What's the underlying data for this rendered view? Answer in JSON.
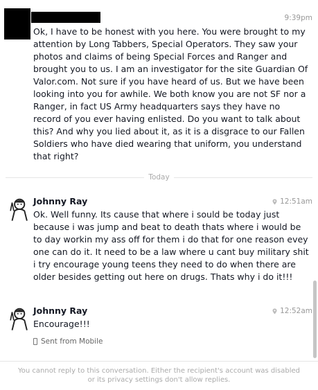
{
  "messages": [
    {
      "sender": "",
      "time": "9:39pm",
      "text": "Ok, I have to be honest with you here. You were brought to my attention by Long Tabbers, Special Operators. They saw your photos and claims of being Special Forces and Ranger and brought you to us. I am an investigator for the site Guardian Of Valor.com. Not sure if you have heard of us. But we have been looking into you for awhile. We both know you are not SF nor a Ranger, in fact US Army headquarters says they have no record of you ever having enlisted. Do you want to talk about this? And why you lied about it, as it is a disgrace to our Fallen Soldiers who have died wearing that uniform, you understand that right?"
    },
    {
      "sender": "Johnny Ray",
      "time": "12:51am",
      "text": "Ok. Well funny. Its cause that where i sould be today just because i was jump and beat to death thats where i would be to day workin my ass off for them i do that for one reason evey one can do it. It need to be a law where u cant buy military shit i try encourage young teens they need to do when there are older besides getting out here on drugs. Thats why i do it!!!"
    },
    {
      "sender": "Johnny Ray",
      "time": "12:52am",
      "text": "Encourage!!!",
      "via": "Sent from Mobile"
    }
  ],
  "divider_label": "Today",
  "footer_notice": "You cannot reply to this conversation. Either the recipient's account was disabled or its privacy settings don't allow replies."
}
